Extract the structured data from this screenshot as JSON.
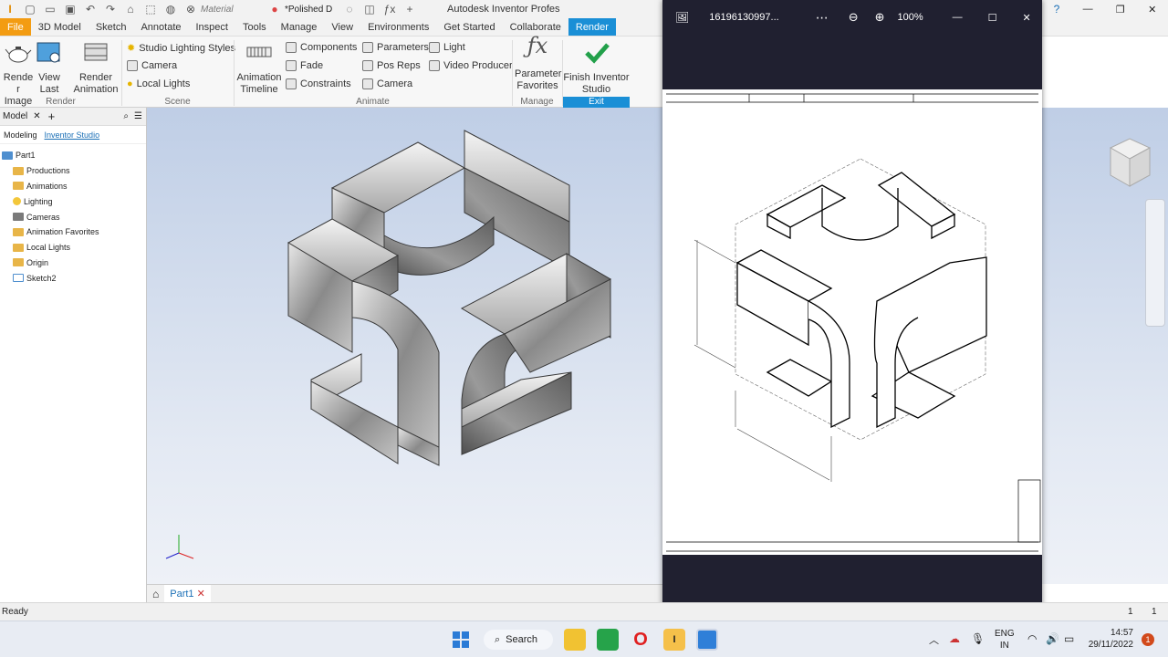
{
  "app": {
    "title": "Autodesk Inventor Profes",
    "material": "Material",
    "appearance": "*Polished D"
  },
  "tabs": [
    "File",
    "3D Model",
    "Sketch",
    "Annotate",
    "Inspect",
    "Tools",
    "Manage",
    "View",
    "Environments",
    "Get Started",
    "Collaborate",
    "Render"
  ],
  "ribbon": {
    "render_image": "Render Image",
    "view_last": "View Last",
    "render_animation": "Render Animation",
    "studio_lighting": "Studio Lighting Styles",
    "camera": "Camera",
    "local_lights": "Local Lights",
    "animation_timeline": "Animation Timeline",
    "components": "Components",
    "fade": "Fade",
    "constraints": "Constraints",
    "parameters": "Parameters",
    "pos_reps": "Pos Reps",
    "camera2": "Camera",
    "light": "Light",
    "video_producer": "Video Producer",
    "parameter_favorites": "Parameter Favorites",
    "finish": "Finish Inventor Studio",
    "panels": {
      "render": "Render",
      "scene": "Scene",
      "animate": "Animate",
      "manage": "Manage",
      "exit": "Exit"
    }
  },
  "browser": {
    "title": "Model",
    "tab_modeling": "Modeling",
    "tab_studio": "Inventor Studio",
    "nodes": [
      "Part1",
      "Productions",
      "Animations",
      "Lighting",
      "Cameras",
      "Animation Favorites",
      "Local Lights",
      "Origin",
      "Sketch2"
    ]
  },
  "doc_tab": "Part1",
  "status": {
    "text": "Ready",
    "n1": "1",
    "n2": "1"
  },
  "photos": {
    "filename": "16196130997...",
    "zoom": "100%"
  },
  "taskbar": {
    "search": "Search",
    "lang": "ENG",
    "region": "IN",
    "time": "14:57",
    "date": "29/11/2022",
    "badge": "1"
  },
  "colors": {
    "accent": "#1a8fd6",
    "file_tab": "#f39c12",
    "check": "#22a04a"
  }
}
